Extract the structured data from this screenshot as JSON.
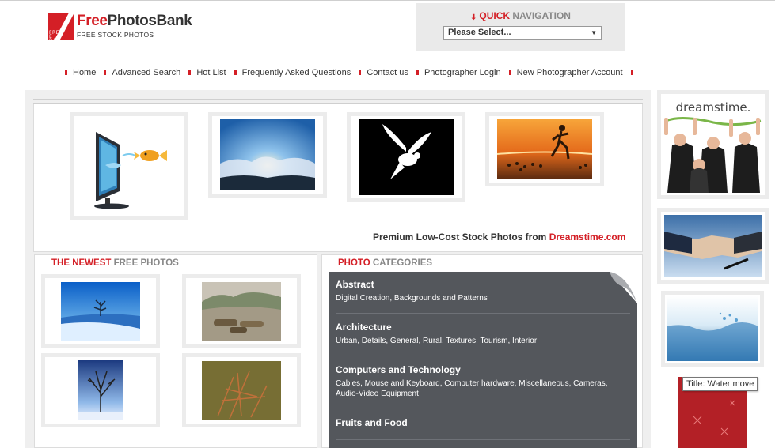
{
  "logo": {
    "brand_part1": "Free",
    "brand_part2": "PhotosBank",
    "subtitle": "FREE STOCK PHOTOS",
    "badge_text": "FREE BANK"
  },
  "quick_nav": {
    "title_part1": "QUICK",
    "title_part2": "NAVIGATION",
    "select_value": "Please Select..."
  },
  "menu": {
    "items": [
      "Home",
      "Advanced Search",
      "Hot List",
      "Frequently Asked Questions",
      "Contact us",
      "Photographer Login",
      "New Photographer Account"
    ]
  },
  "featured": {
    "promo_text": "Premium Low-Cost Stock Photos from ",
    "promo_link": "Dreamstime.com",
    "images": [
      {
        "icon": "monitor-goldfish-image"
      },
      {
        "icon": "sunrays-clouds-image"
      },
      {
        "icon": "white-dove-image"
      },
      {
        "icon": "runner-beach-sunset-image"
      }
    ]
  },
  "newest": {
    "title_part1": "THE NEWEST",
    "title_part2": "FREE PHOTOS",
    "images": [
      {
        "icon": "winter-tree-image"
      },
      {
        "icon": "logs-landscape-image"
      },
      {
        "icon": "frozen-tree-image"
      },
      {
        "icon": "dry-plant-image"
      }
    ]
  },
  "categories": {
    "title_part1": "PHOTO",
    "title_part2": "CATEGORIES",
    "items": [
      {
        "title": "Abstract",
        "desc": "Digital Creation, Backgrounds and Patterns"
      },
      {
        "title": "Architecture",
        "desc": "Urban, Details, General, Rural, Textures, Tourism, Interior"
      },
      {
        "title": "Computers and Technology",
        "desc": "Cables, Mouse and Keyboard, Computer hardware, Miscellaneous, Cameras, Audio-Video Equipment"
      },
      {
        "title": "Fruits and Food",
        "desc": ""
      }
    ]
  },
  "sidebar": {
    "ad_brand": "dreamstime.",
    "tooltip": "Title: Water move",
    "images": [
      {
        "icon": "dreamstime-team-ad-image"
      },
      {
        "icon": "handshake-image"
      },
      {
        "icon": "water-splash-image"
      },
      {
        "icon": "red-christmas-image"
      }
    ]
  },
  "colors": {
    "accent_red": "#d41f26",
    "category_panel": "#54575c",
    "panel_bg": "#efefef"
  }
}
